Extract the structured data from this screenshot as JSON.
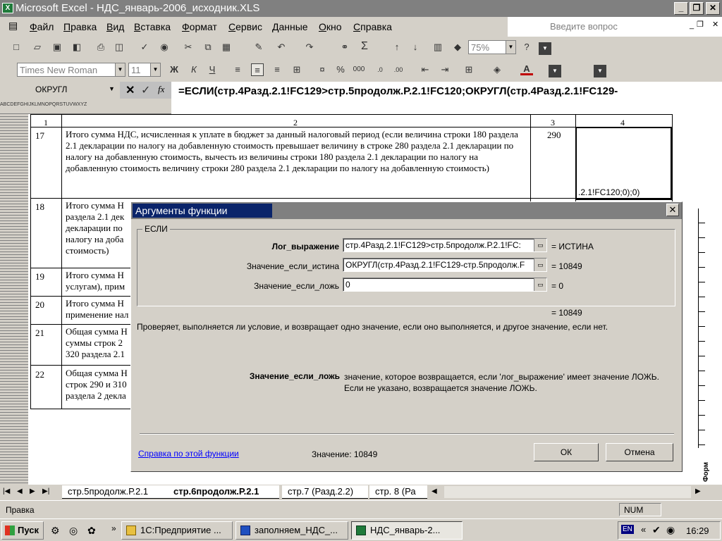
{
  "window": {
    "title": "Microsoft Excel - НДС_январь-2006_исходник.XLS",
    "help_placeholder": "Введите вопрос"
  },
  "menu": [
    "Файл",
    "Правка",
    "Вид",
    "Вставка",
    "Формат",
    "Сервис",
    "Данные",
    "Окно",
    "Справка"
  ],
  "toolbar": {
    "zoom": "75%",
    "font_name": "Times New Roman",
    "font_size": "11",
    "bold": "Ж",
    "italic": "К",
    "underline": "Ч",
    "sum": "Σ"
  },
  "formula_bar": {
    "name_box": "ОКРУГЛ",
    "formula": "=ЕСЛИ(стр.4Разд.2.1!FC129>стр.5продолж.Р.2.1!FC120;ОКРУГЛ(стр.4Разд.2.1!FC129-стр.5продолж.Р.2.1!FC120;0);0)",
    "col_strip": "ABCDEFGHIJKLMNOPQRSTUVWXYZ"
  },
  "sheet": {
    "col_headers": [
      "1",
      "2",
      "3",
      "4"
    ],
    "rows": [
      {
        "num": "17",
        "text": "Итого сумма НДС, исчисленная к уплате в бюджет за данный налоговый период (если величина строки 180 раздела 2.1 декларации по налогу на добавленную стоимость превышает величину в строке 280 раздела 2.1 декларации по налогу на добавленную стоимость, вычесть из величины строки 180 раздела 2.1 декларации по налогу на добавленную стоимость величину строки 280 раздела 2.1 декларации по налогу на добавленную стоимость)",
        "code": "290",
        "value": ".2.1!FC120;0);0)"
      },
      {
        "num": "18",
        "text": "Итого сумма Н раздела 2.1 дек декларации по налогу на доба стоимость)",
        "code": "",
        "value": ""
      },
      {
        "num": "19",
        "text": "Итого сумма Н услугам), прим",
        "code": "",
        "value": ""
      },
      {
        "num": "20",
        "text": "Итого сумма Н применение нал",
        "code": "",
        "value": ""
      },
      {
        "num": "21",
        "text": "Общая сумма Н суммы строк 2 320 раздела 2.1",
        "code": "",
        "value": ""
      },
      {
        "num": "22",
        "text": "Общая сумма Н строк 290 и 310 раздела 2 декла",
        "code": "",
        "value": ""
      }
    ]
  },
  "dialog": {
    "title": "Аргументы функции",
    "group_label": "ЕСЛИ",
    "args": [
      {
        "label": "Лог_выражение",
        "value": "стр.4Разд.2.1!FC129>стр.5продолж.Р.2.1!FC:",
        "result": "= ИСТИНА"
      },
      {
        "label": "Значение_если_истина",
        "value": "ОКРУГЛ(стр.4Разд.2.1!FC129-стр.5продолж.F",
        "result": "= 10849"
      },
      {
        "label": "Значение_если_ложь",
        "value": "0",
        "result": "= 0"
      }
    ],
    "total_result": "= 10849",
    "description": "Проверяет, выполняется ли условие, и возвращает одно значение, если оно выполняется, и другое значение, если нет.",
    "arg_help_name": "Значение_если_ложь",
    "arg_help_text": "значение, которое возвращается, если 'лог_выражение' имеет значение ЛОЖЬ. Если не указано, возвращается значение ЛОЖЬ.",
    "help_link": "Справка по этой функции",
    "value_label": "Значение: 10849",
    "ok": "ОК",
    "cancel": "Отмена"
  },
  "sheet_tabs": [
    "стр.5продолж.Р.2.1",
    "стр.6продолж.Р.2.1",
    "стр.7 (Разд.2.2)",
    "стр. 8 (Ра"
  ],
  "active_tab": 1,
  "status": {
    "mode": "Правка",
    "num": "NUM"
  },
  "taskbar": {
    "start": "Пуск",
    "tasks": [
      "1С:Предприятие ...",
      "заполняем_НДС_...",
      "НДС_январь-2..."
    ],
    "lang": "EN",
    "clock": "16:29"
  },
  "right_strip_label": "Форм"
}
